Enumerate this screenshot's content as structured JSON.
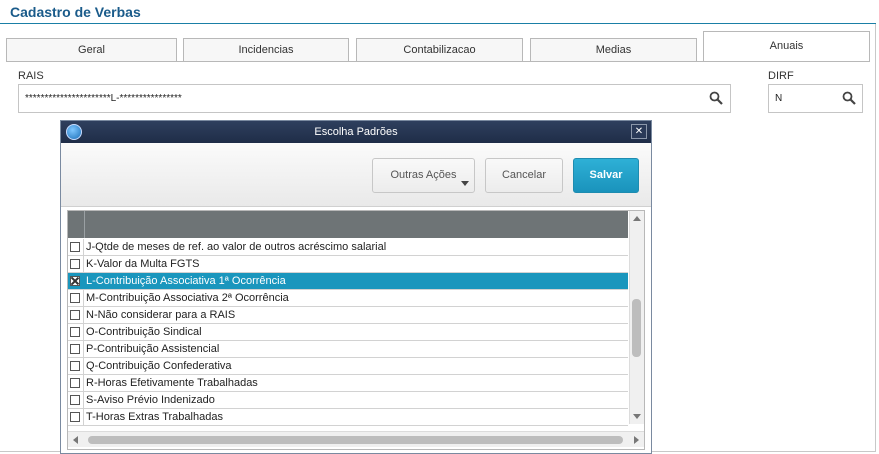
{
  "page": {
    "title": "Cadastro de Verbas"
  },
  "tabs": [
    {
      "label": "Geral"
    },
    {
      "label": "Incidencias"
    },
    {
      "label": "Contabilizacao"
    },
    {
      "label": "Medias"
    },
    {
      "label": "Anuais",
      "active": true
    }
  ],
  "rais": {
    "label": "RAIS",
    "value": "**********************L-****************"
  },
  "dirf": {
    "label": "DIRF",
    "value": "N"
  },
  "dialog": {
    "title": "Escolha Padrões",
    "buttons": {
      "other": "Outras Ações",
      "cancel": "Cancelar",
      "save": "Salvar"
    },
    "rows": [
      {
        "text": "J-Qtde de meses de ref. ao valor de outros acréscimo salarial",
        "checked": false
      },
      {
        "text": "K-Valor da Multa FGTS",
        "checked": false
      },
      {
        "text": "L-Contribuição Associativa 1ª Ocorrência",
        "checked": true,
        "selected": true
      },
      {
        "text": "M-Contribuição Associativa 2ª Ocorrência",
        "checked": false
      },
      {
        "text": "N-Não considerar para a RAIS",
        "checked": false
      },
      {
        "text": "O-Contribuição Sindical",
        "checked": false
      },
      {
        "text": "P-Contribuição Assistencial",
        "checked": false
      },
      {
        "text": "Q-Contribuição Confederativa",
        "checked": false
      },
      {
        "text": "R-Horas Efetivamente Trabalhadas",
        "checked": false
      },
      {
        "text": "S-Aviso Prévio Indenizado",
        "checked": false
      },
      {
        "text": "T-Horas Extras Trabalhadas",
        "checked": false
      }
    ]
  },
  "colors": {
    "accent": "#1a96bd",
    "title": "#1a5b8a",
    "dialog_title_bg": "#26365a",
    "grid_header": "#6e7476"
  }
}
